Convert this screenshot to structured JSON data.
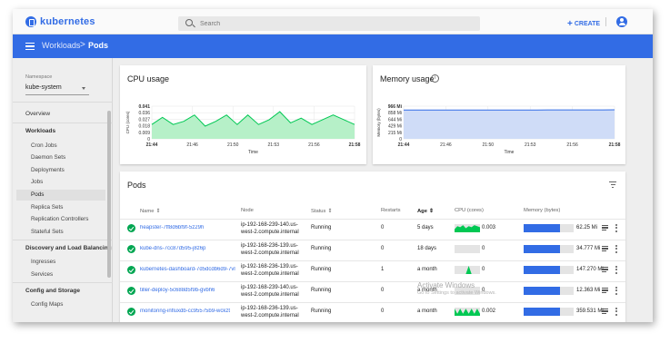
{
  "app": {
    "brand": "kubernetes"
  },
  "search": {
    "placeholder": "Search"
  },
  "topbar": {
    "create_label": "CREATE",
    "create_icon": "plus-icon",
    "account_icon": "account-circle-icon"
  },
  "breadcrumb": {
    "section": "Workloads",
    "separator": ">",
    "current": "Pods"
  },
  "colors": {
    "primary": "#326ce5",
    "cpu_fill": "#b6f0c8",
    "cpu_line": "#00c853",
    "mem_fill": "#cfdcf7",
    "status_ok": "#00a651"
  },
  "sidebar": {
    "namespace_label": "Namespace",
    "namespace_value": "kube-system",
    "overview": "Overview",
    "workloads_head": "Workloads",
    "workloads": [
      "Cron Jobs",
      "Daemon Sets",
      "Deployments",
      "Jobs",
      "Pods",
      "Replica Sets",
      "Replication Controllers",
      "Stateful Sets"
    ],
    "active_item": "Pods",
    "discovery_head": "Discovery and Load Balancing",
    "discovery": [
      "Ingresses",
      "Services"
    ],
    "config_head": "Config and Storage",
    "config": [
      "Config Maps"
    ]
  },
  "cpu": {
    "title": "CPU usage"
  },
  "memory": {
    "title": "Memory usage",
    "info_icon": "info-icon"
  },
  "chart_data": [
    {
      "type": "area",
      "title": "CPU usage",
      "xlabel": "Time",
      "ylabel": "CPU (cores)",
      "y_ticks": [
        "0.041",
        "0.036",
        "0.027",
        "0.018",
        "0.009",
        "0"
      ],
      "ylim": [
        0,
        0.041
      ],
      "x_ticks": [
        "21:44",
        "21:46",
        "21:50",
        "21:53",
        "21:56",
        "21:58"
      ],
      "x": [
        0,
        1,
        2,
        3,
        4,
        5,
        6,
        7,
        8,
        9,
        10,
        11,
        12,
        13,
        14,
        15,
        16,
        17,
        18,
        19
      ],
      "values": [
        0.018,
        0.027,
        0.018,
        0.022,
        0.03,
        0.016,
        0.022,
        0.03,
        0.018,
        0.03,
        0.018,
        0.024,
        0.034,
        0.02,
        0.026,
        0.018,
        0.024,
        0.03,
        0.024,
        0.018
      ]
    },
    {
      "type": "area",
      "title": "Memory usage",
      "xlabel": "Time",
      "ylabel": "Memory (bytes)",
      "y_ticks": [
        "966 Mi",
        "858 Mi",
        "644 Mi",
        "429 Mi",
        "215 Mi",
        "0"
      ],
      "ylim": [
        0,
        966
      ],
      "x_ticks": [
        "21:44",
        "21:46",
        "21:50",
        "21:53",
        "21:56",
        "21:58"
      ],
      "x": [
        0,
        1,
        2,
        3,
        4,
        5,
        6,
        7,
        8,
        9,
        10,
        11,
        12,
        13,
        14,
        15,
        16,
        17,
        18,
        19
      ],
      "values": [
        850,
        850,
        851,
        851,
        851,
        852,
        852,
        852,
        853,
        853,
        853,
        854,
        854,
        855,
        855,
        856,
        856,
        857,
        857,
        858
      ]
    }
  ],
  "pods": {
    "title": "Pods",
    "filter_icon": "filter-icon",
    "columns": {
      "name": "Name",
      "node": "Node",
      "status": "Status",
      "restarts": "Restarts",
      "age": "Age",
      "cpu": "CPU (cores)",
      "memory": "Memory (bytes)"
    },
    "rows": [
      {
        "name": "heapster-7ff8d6bf9f-5z29h",
        "node_line1": "ip-192-168-239-140.us-",
        "node_line2": "west-2.compute.internal",
        "status": "Running",
        "restarts": "0",
        "age": "5 days",
        "cpu": "0.003",
        "memory": "62.25 Mi",
        "memory_fraction": 0.72,
        "cpu_spark": [
          3,
          6,
          5,
          7,
          4,
          6,
          5,
          7,
          6,
          5
        ]
      },
      {
        "name": "kube-dns-7cc87d595-j8z6p",
        "node_line1": "ip-192-168-236-139.us-",
        "node_line2": "west-2.compute.internal",
        "status": "Running",
        "restarts": "0",
        "age": "18 days",
        "cpu": "0",
        "memory": "34.777 Mi",
        "memory_fraction": 0.72,
        "cpu_spark": []
      },
      {
        "name": "kubernetes-dashboard-7d5dcdb6d9-7vl",
        "node_line1": "ip-192-168-236-139.us-",
        "node_line2": "west-2.compute.internal",
        "status": "Running",
        "restarts": "1",
        "age": "a month",
        "cpu": "0",
        "memory": "147.270 Mi",
        "memory_fraction": 0.72,
        "cpu_spark": [
          0,
          0,
          0,
          0,
          0,
          8,
          0,
          0,
          0,
          0
        ]
      },
      {
        "name": "tiller-deploy-5c688d5f9b-gvbh6",
        "node_line1": "ip-192-168-239-140.us-",
        "node_line2": "west-2.compute.internal",
        "status": "Running",
        "restarts": "0",
        "age": "a month",
        "cpu": "0",
        "memory": "12.363 Mi",
        "memory_fraction": 0.72,
        "cpu_spark": []
      },
      {
        "name": "monitoring-influxdb-cc95575b9-wckzt",
        "node_line1": "ip-192-168-236-139.us-",
        "node_line2": "west-2.compute.internal",
        "status": "Running",
        "restarts": "0",
        "age": "a month",
        "cpu": "0.002",
        "memory": "359.531 Mi",
        "memory_fraction": 0.72,
        "cpu_spark": [
          7,
          2,
          7,
          2,
          7,
          2,
          7,
          2,
          7,
          2
        ]
      }
    ]
  },
  "watermark": {
    "line1": "Activate Windows",
    "line2": "Go to Settings to activate Windows."
  }
}
